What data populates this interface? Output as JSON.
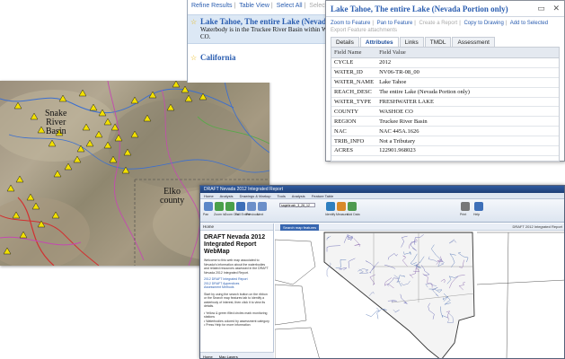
{
  "terrain_map": {
    "labels": {
      "snake_river_basin": "Snake\nRiver\nBasin",
      "elko_county": "Elko\ncounty"
    },
    "colors": {
      "marker_fill": "#f2e000",
      "stream_blue": "#3b6fd0",
      "stream_magenta": "#c44ab0",
      "stream_red": "#d23030",
      "stream_green": "#5aa84a"
    }
  },
  "results_panel": {
    "toolbar": {
      "refine": "Refine Results",
      "table_view": "Table View",
      "select_all": "Select All",
      "select_none": "Select None"
    },
    "items": [
      {
        "title": "Lake Tahoe, The entire Lake (Nevada Portion only)",
        "description": "Waterbody is in the Truckee River Basin within WASHOE CO."
      },
      {
        "title": "California",
        "description": ""
      }
    ]
  },
  "popup": {
    "title": "Lake Tahoe, The entire Lake (Nevada Portion only)",
    "icons": [
      "minimize-icon",
      "close-icon"
    ],
    "actions": {
      "zoom": "Zoom to Feature",
      "pan": "Pan to Feature",
      "create_report": "Create a Report",
      "copy": "Copy to Drawing",
      "add_selected": "Add to Selected",
      "export": "Export Feature attachments"
    },
    "tabs": [
      "Details",
      "Attributes",
      "Links",
      "TMDL",
      "Assessment"
    ],
    "active_tab": "Attributes",
    "columns": [
      "Field Name",
      "Field Value"
    ],
    "rows": [
      [
        "CYCLE",
        "2012"
      ],
      [
        "WATER_ID",
        "NV06-TR-08_00"
      ],
      [
        "WATER_NAME",
        "Lake Tahoe"
      ],
      [
        "REACH_DESC",
        "The entire Lake (Nevada Portion only)"
      ],
      [
        "WATER_TYPE",
        "FRESHWATER LAKE"
      ],
      [
        "COUNTY",
        "WASHOE CO"
      ],
      [
        "REGION",
        "Truckee River Basin"
      ],
      [
        "NAC",
        "NAC 445A.1626"
      ],
      [
        "TRIB_INFO",
        "Not a Tributary"
      ],
      [
        "ACRES",
        "122901.968023"
      ]
    ]
  },
  "app_window": {
    "title": "DRAFT Nevada 2012 Integrated Report",
    "menu_tabs": [
      "Home",
      "Analysis",
      "Drawings & Markup",
      "Tools",
      "Analysis",
      "Feature Table"
    ],
    "ribbon": {
      "buttons": [
        "Pan",
        "Zoom In",
        "Zoom Out",
        "Full Extent",
        "Previous",
        "Next",
        "Identify",
        "Measure",
        "Add Data",
        "Print",
        "Help"
      ],
      "search_value": "sagebrush_3_26_12"
    },
    "sidebar": {
      "header": "Home",
      "title": "DRAFT Nevada 2012 Integrated Report WebMap",
      "intro": "Welcome to this web map associated to Nevada's information about the waterbodies and related resources assessed in the DRAFT Nevada 2012 Integrated Report.",
      "links": [
        "2012 DRAFT Integrated Report",
        "2012 DRAFT Appendices",
        "Assessment Methods"
      ],
      "instructions": "Start by using the search button on the ribbon or the Search map features tab to identify a waterbody of interest, then click it to view its details.",
      "bullets": [
        "Yellow & green filled circles mark monitoring stations",
        "Waterbodies colored by assessment category",
        "Press Help for more information"
      ],
      "footer": [
        "Home",
        "Map Layers"
      ]
    },
    "map": {
      "tab": "Search map features",
      "right_label": "DRAFT 2012 Integrated Report"
    }
  }
}
